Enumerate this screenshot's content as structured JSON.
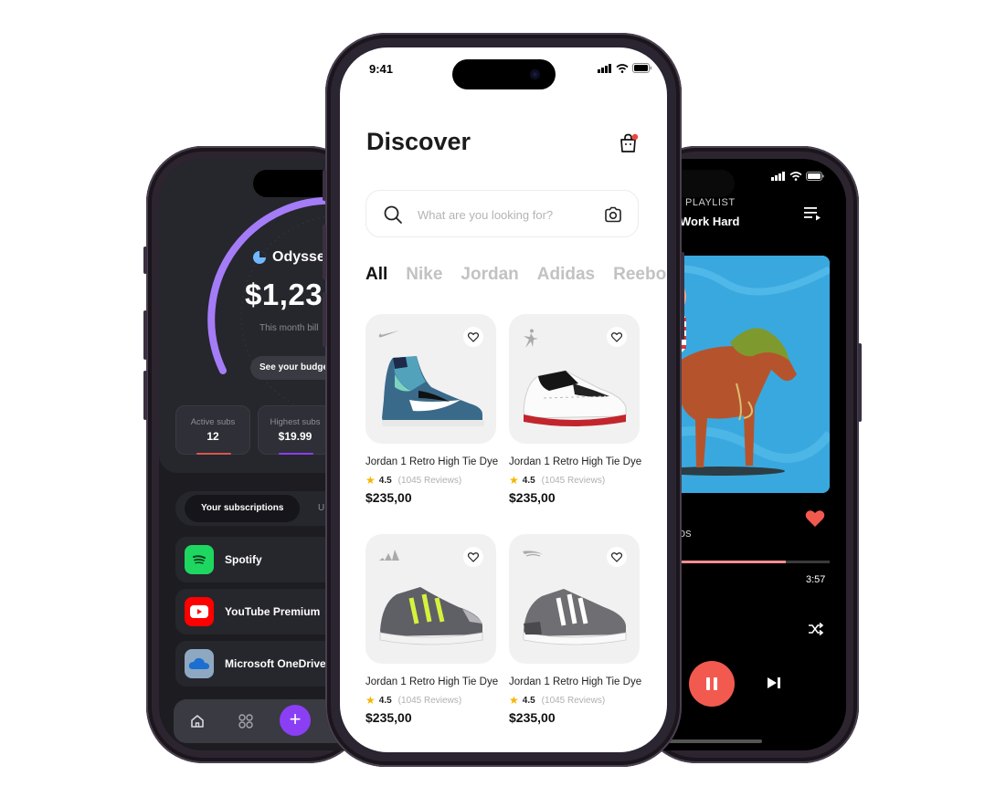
{
  "finance": {
    "brand": "Odysse",
    "amount": "$1,23",
    "amount_caption": "This month bill",
    "budget_button": "See your budge",
    "stats": [
      {
        "label": "Active subs",
        "value": "12",
        "bar_color": "#d9574c"
      },
      {
        "label": "Highest subs",
        "value": "$19.99",
        "bar_color": "#8b3ff5"
      }
    ],
    "tabs": {
      "active": "Your subscriptions",
      "other": "U"
    },
    "subscriptions": [
      {
        "name": "Spotify",
        "icon": "spotify-icon",
        "color": "#1ed760"
      },
      {
        "name": "YouTube Premium",
        "icon": "youtube-icon",
        "color": "#ff0000"
      },
      {
        "name": "Microsoft OneDrive",
        "icon": "onedrive-icon",
        "color": "#8fa8c2"
      }
    ],
    "nav": [
      "home-icon",
      "grid-icon",
      "plus-icon"
    ],
    "accent": "#8b3ff5"
  },
  "shop": {
    "status_time": "9:41",
    "title": "Discover",
    "search_placeholder": "What are you looking for?",
    "brands": [
      "All",
      "Nike",
      "Jordan",
      "Adidas",
      "Reebok"
    ],
    "active_brand": "All",
    "products": [
      {
        "brand": "nike",
        "title": "Jordan 1 Retro High Tie Dye",
        "rating": "4.5",
        "reviews": "(1045 Reviews)",
        "price": "$235,00"
      },
      {
        "brand": "jordan",
        "title": "Jordan 1 Retro High Tie Dye",
        "rating": "4.5",
        "reviews": "(1045 Reviews)",
        "price": "$235,00"
      },
      {
        "brand": "adidas",
        "title": "Jordan 1 Retro High Tie Dye",
        "rating": "4.5",
        "reviews": "(1045 Reviews)",
        "price": "$235,00"
      },
      {
        "brand": "reebok",
        "title": "Jordan 1 Retro High Tie Dye",
        "rating": "4.5",
        "reviews": "(1045 Reviews)",
        "price": "$235,00"
      }
    ]
  },
  "music": {
    "playlist_label": "PLAYLIST",
    "playlist_name": "Work Hard",
    "artist_partial": "los",
    "time_end": "3:57",
    "progress": 0.75,
    "accent": "#f35a4f",
    "liked": true
  }
}
